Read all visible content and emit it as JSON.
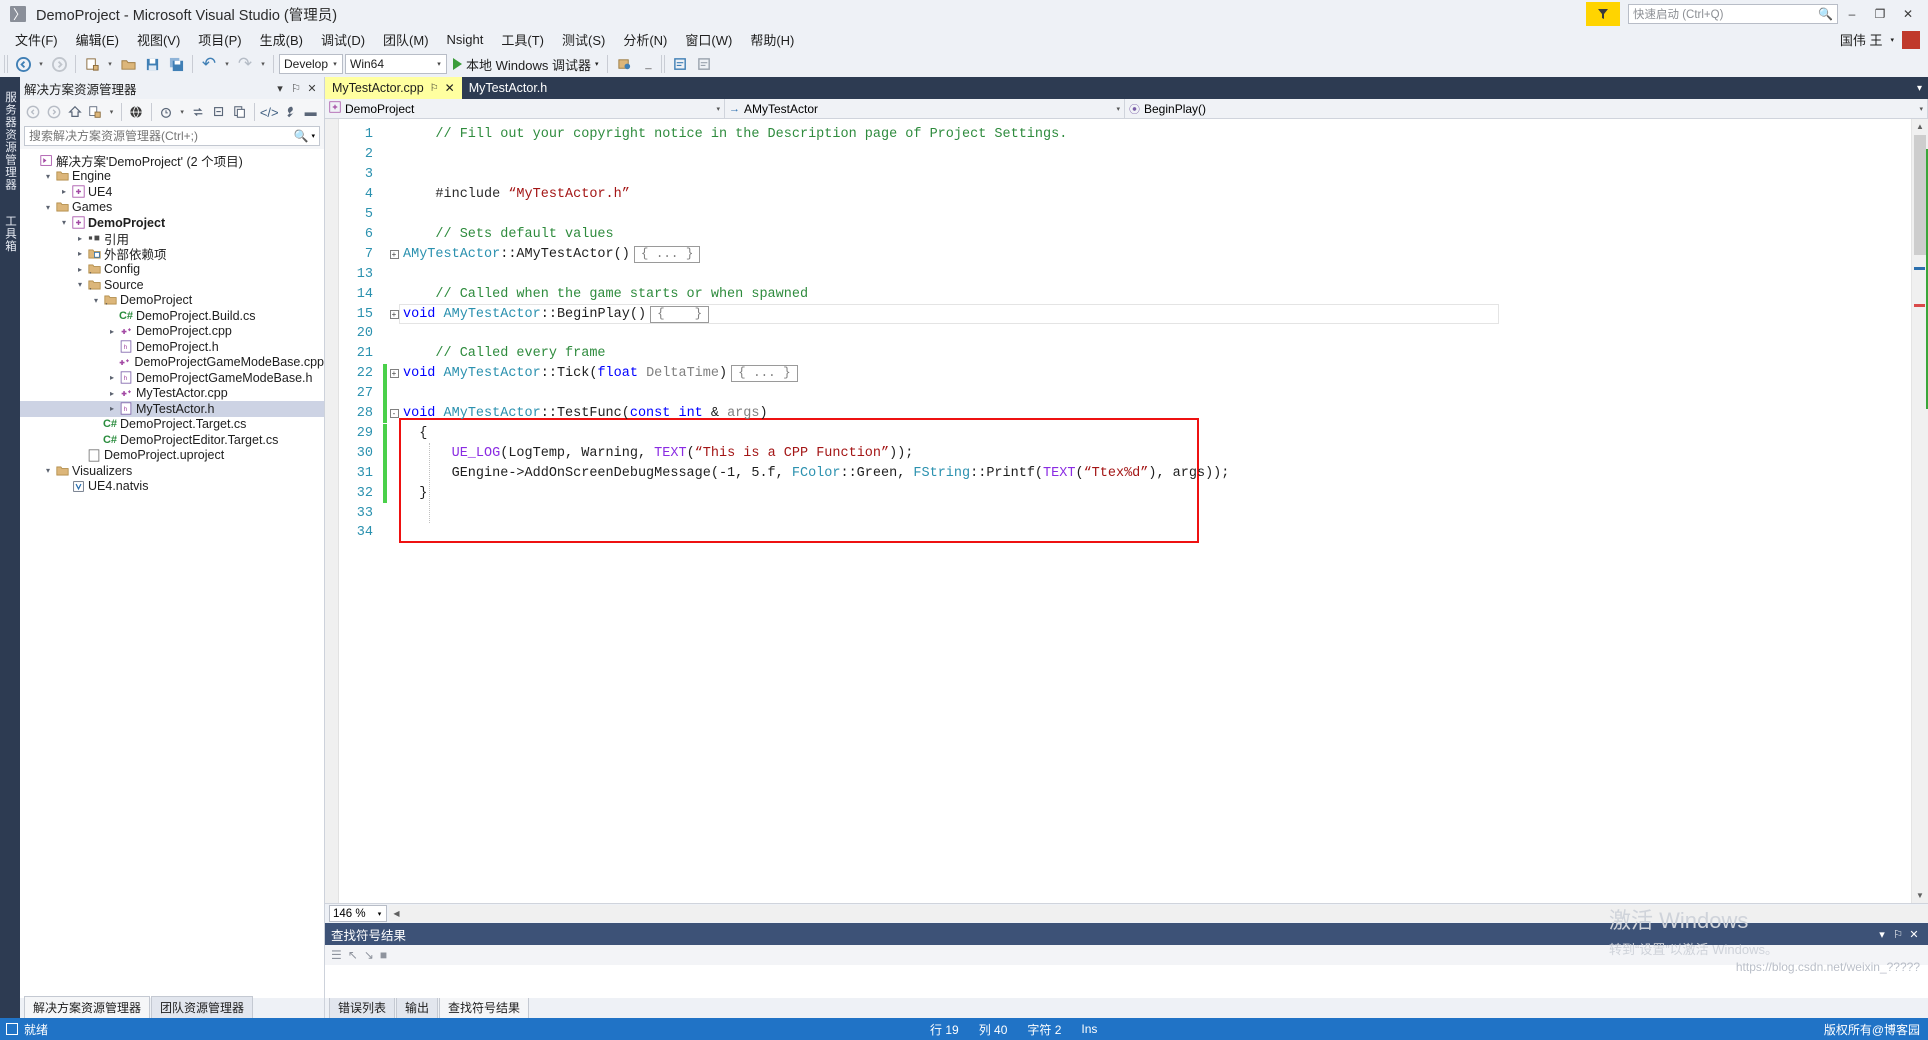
{
  "window": {
    "title": "DemoProject - Microsoft Visual Studio (管理员)",
    "logo_icon": "visual-studio-logo",
    "minimize": "–",
    "maximize": "❐",
    "close": "✕"
  },
  "menubar": {
    "items": [
      {
        "label": "文件(F)"
      },
      {
        "label": "编辑(E)"
      },
      {
        "label": "视图(V)"
      },
      {
        "label": "项目(P)"
      },
      {
        "label": "生成(B)"
      },
      {
        "label": "调试(D)"
      },
      {
        "label": "团队(M)"
      },
      {
        "label": "Nsight"
      },
      {
        "label": "工具(T)"
      },
      {
        "label": "测试(S)"
      },
      {
        "label": "分析(N)"
      },
      {
        "label": "窗口(W)"
      },
      {
        "label": "帮助(H)"
      }
    ],
    "user": "国伟 王",
    "user_caret": "▾",
    "user_badge": "■"
  },
  "quick_launch": {
    "placeholder": "快速启动 (Ctrl+Q)",
    "icon": "search-icon"
  },
  "toolbar": {
    "back_icon": "◀",
    "forward_icon": "▶",
    "new_item_icon": "⬚",
    "open_icon": "◱",
    "save_icon": "Ὃe",
    "save_all_icon": "❐",
    "undo_icon": "↶",
    "redo_icon": "↷",
    "config": "Develop",
    "platform": "Win64",
    "run_label": "本地 Windows 调试器",
    "caret": "▾"
  },
  "left_strip": {
    "tabs": [
      "服务器资源管理器",
      "工具箱"
    ]
  },
  "solution_explorer": {
    "title": "解决方案资源管理器",
    "header_buttons": [
      "▾",
      "⚐",
      "✕"
    ],
    "toolbar_icons": [
      "back-icon",
      "forward-icon",
      "home-icon",
      "sync-with-active-document-icon",
      "caret-down-icon",
      "show-all-files-icon",
      "pending-changes-filter-icon",
      "refresh-icon",
      "collapse-all-icon",
      "properties-icon",
      "view-code-icon",
      "properties-wrench-icon",
      "preview-icon"
    ],
    "search_placeholder": "搜索解决方案资源管理器(Ctrl+;)",
    "search_icon": "magnifier-icon",
    "tree": [
      {
        "depth": 0,
        "expander": "",
        "icon": "solution",
        "label": "解决方案'DemoProject' (2 个项目)",
        "bold": false,
        "selected": false
      },
      {
        "depth": 1,
        "expander": "▾",
        "icon": "folder",
        "label": "Engine",
        "bold": false,
        "selected": false
      },
      {
        "depth": 2,
        "expander": "▸",
        "icon": "project",
        "label": "UE4",
        "bold": false,
        "selected": false
      },
      {
        "depth": 1,
        "expander": "▾",
        "icon": "folder",
        "label": "Games",
        "bold": false,
        "selected": false
      },
      {
        "depth": 2,
        "expander": "▾",
        "icon": "project",
        "label": "DemoProject",
        "bold": true,
        "selected": false
      },
      {
        "depth": 3,
        "expander": "▸",
        "icon": "references",
        "label": "引用",
        "bold": false,
        "selected": false
      },
      {
        "depth": 3,
        "expander": "▸",
        "icon": "extdeps",
        "label": "外部依赖项",
        "bold": false,
        "selected": false
      },
      {
        "depth": 3,
        "expander": "▸",
        "icon": "filter-folder",
        "label": "Config",
        "bold": false,
        "selected": false
      },
      {
        "depth": 3,
        "expander": "▾",
        "icon": "filter-folder",
        "label": "Source",
        "bold": false,
        "selected": false
      },
      {
        "depth": 4,
        "expander": "▾",
        "icon": "filter-folder",
        "label": "DemoProject",
        "bold": false,
        "selected": false
      },
      {
        "depth": 5,
        "expander": "",
        "icon": "csharp",
        "label": "DemoProject.Build.cs",
        "bold": false,
        "selected": false
      },
      {
        "depth": 5,
        "expander": "▸",
        "icon": "cpp",
        "label": "DemoProject.cpp",
        "bold": false,
        "selected": false
      },
      {
        "depth": 5,
        "expander": "",
        "icon": "header",
        "label": "DemoProject.h",
        "bold": false,
        "selected": false
      },
      {
        "depth": 5,
        "expander": "",
        "icon": "cpp",
        "label": "DemoProjectGameModeBase.cpp",
        "bold": false,
        "selected": false
      },
      {
        "depth": 5,
        "expander": "▸",
        "icon": "header",
        "label": "DemoProjectGameModeBase.h",
        "bold": false,
        "selected": false
      },
      {
        "depth": 5,
        "expander": "▸",
        "icon": "cpp",
        "label": "MyTestActor.cpp",
        "bold": false,
        "selected": false
      },
      {
        "depth": 5,
        "expander": "▸",
        "icon": "header",
        "label": "MyTestActor.h",
        "bold": false,
        "selected": true
      },
      {
        "depth": 4,
        "expander": "",
        "icon": "csharp",
        "label": "DemoProject.Target.cs",
        "bold": false,
        "selected": false
      },
      {
        "depth": 4,
        "expander": "",
        "icon": "csharp",
        "label": "DemoProjectEditor.Target.cs",
        "bold": false,
        "selected": false
      },
      {
        "depth": 3,
        "expander": "",
        "icon": "file",
        "label": "DemoProject.uproject",
        "bold": false,
        "selected": false
      },
      {
        "depth": 1,
        "expander": "▾",
        "icon": "folder",
        "label": "Visualizers",
        "bold": false,
        "selected": false
      },
      {
        "depth": 2,
        "expander": "",
        "icon": "natvis",
        "label": "UE4.natvis",
        "bold": false,
        "selected": false
      }
    ],
    "bottom_tabs": [
      {
        "label": "解决方案资源管理器",
        "active": true
      },
      {
        "label": "团队资源管理器",
        "active": false
      }
    ]
  },
  "editor": {
    "tabs": [
      {
        "label": "MyTestActor.cpp",
        "active": true,
        "pin": "⚐",
        "close": "✕"
      },
      {
        "label": "MyTestActor.h",
        "active": false
      }
    ],
    "navbar": {
      "project": "DemoProject",
      "project_icon": "project-icon",
      "class": "AMyTestActor",
      "class_icon": "→",
      "member": "BeginPlay()",
      "member_icon": "⦿",
      "caret": "▾"
    },
    "zoom": "146 %",
    "lines": [
      {
        "num": "1",
        "changebar": "none",
        "fold": "",
        "segments": [
          {
            "t": "    // Fill out your copyright notice in the Description page of Project Settings.",
            "c": "c-com"
          }
        ]
      },
      {
        "num": "2",
        "changebar": "none",
        "fold": "",
        "segments": []
      },
      {
        "num": "3",
        "changebar": "none",
        "fold": "",
        "segments": []
      },
      {
        "num": "4",
        "changebar": "none",
        "fold": "",
        "segments": [
          {
            "t": "    #include ",
            "c": "c-pre"
          },
          {
            "t": "“MyTestActor.h”",
            "c": "c-str"
          }
        ]
      },
      {
        "num": "5",
        "changebar": "none",
        "fold": "",
        "segments": []
      },
      {
        "num": "6",
        "changebar": "none",
        "fold": "",
        "segments": [
          {
            "t": "    // Sets default values",
            "c": "c-com"
          }
        ]
      },
      {
        "num": "7",
        "changebar": "none",
        "fold": "+",
        "segments": [
          {
            "t": "AMyTestActor",
            "c": "c-type"
          },
          {
            "t": "::",
            "c": "c-id"
          },
          {
            "t": "AMyTestActor",
            "c": "c-fn"
          },
          {
            "t": "()",
            "c": "c-id"
          }
        ],
        "collapsed": "{ ... }"
      },
      {
        "num": "13",
        "changebar": "none",
        "fold": "",
        "segments": []
      },
      {
        "num": "14",
        "changebar": "none",
        "fold": "",
        "segments": [
          {
            "t": "    // Called when the game starts or when spawned",
            "c": "c-com"
          }
        ]
      },
      {
        "num": "15",
        "changebar": "none",
        "fold": "+",
        "segments": [
          {
            "t": "void ",
            "c": "c-kw"
          },
          {
            "t": "AMyTestActor",
            "c": "c-type"
          },
          {
            "t": "::",
            "c": "c-id"
          },
          {
            "t": "BeginPlay",
            "c": "c-fn"
          },
          {
            "t": "()",
            "c": "c-id"
          }
        ],
        "collapsed": "{    }",
        "current": true
      },
      {
        "num": "20",
        "changebar": "none",
        "fold": "",
        "segments": []
      },
      {
        "num": "21",
        "changebar": "none",
        "fold": "",
        "segments": [
          {
            "t": "    // Called every frame",
            "c": "c-com"
          }
        ]
      },
      {
        "num": "22",
        "changebar": "green",
        "fold": "+",
        "segments": [
          {
            "t": "void ",
            "c": "c-kw"
          },
          {
            "t": "AMyTestActor",
            "c": "c-type"
          },
          {
            "t": "::",
            "c": "c-id"
          },
          {
            "t": "Tick",
            "c": "c-fn"
          },
          {
            "t": "(",
            "c": "c-id"
          },
          {
            "t": "float ",
            "c": "c-kw"
          },
          {
            "t": "DeltaTime",
            "c": "c-dim"
          },
          {
            "t": ")",
            "c": "c-id"
          }
        ],
        "collapsed": "{ ... }"
      },
      {
        "num": "27",
        "changebar": "green",
        "fold": "",
        "segments": []
      },
      {
        "num": "28",
        "changebar": "green",
        "fold": "-",
        "segments": [
          {
            "t": "void ",
            "c": "c-kw"
          },
          {
            "t": "AMyTestActor",
            "c": "c-type"
          },
          {
            "t": "::",
            "c": "c-id"
          },
          {
            "t": "TestFunc",
            "c": "c-fn"
          },
          {
            "t": "(",
            "c": "c-id"
          },
          {
            "t": "const int ",
            "c": "c-kw"
          },
          {
            "t": "& ",
            "c": "c-id"
          },
          {
            "t": "args",
            "c": "c-dim"
          },
          {
            "t": ")",
            "c": "c-id"
          }
        ]
      },
      {
        "num": "29",
        "changebar": "green",
        "fold": "",
        "segments": [
          {
            "t": "  {",
            "c": "c-id"
          }
        ]
      },
      {
        "num": "30",
        "changebar": "green",
        "fold": "",
        "segments": [
          {
            "t": "      ",
            "c": "c-id"
          },
          {
            "t": "UE_LOG",
            "c": "c-macro"
          },
          {
            "t": "(LogTemp, Warning, ",
            "c": "c-id"
          },
          {
            "t": "TEXT",
            "c": "c-macro"
          },
          {
            "t": "(",
            "c": "c-id"
          },
          {
            "t": "“This is a CPP Function”",
            "c": "c-str"
          },
          {
            "t": "));",
            "c": "c-id"
          }
        ]
      },
      {
        "num": "31",
        "changebar": "green",
        "fold": "",
        "segments": [
          {
            "t": "      GEngine->AddOnScreenDebugMessage(-1, 5.f, ",
            "c": "c-id"
          },
          {
            "t": "FColor",
            "c": "c-type"
          },
          {
            "t": "::Green, ",
            "c": "c-id"
          },
          {
            "t": "FString",
            "c": "c-type"
          },
          {
            "t": "::Printf(",
            "c": "c-id"
          },
          {
            "t": "TEXT",
            "c": "c-macro"
          },
          {
            "t": "(",
            "c": "c-id"
          },
          {
            "t": "“Ttex%d”",
            "c": "c-str"
          },
          {
            "t": "), args));",
            "c": "c-id"
          }
        ]
      },
      {
        "num": "32",
        "changebar": "green",
        "fold": "",
        "segments": [
          {
            "t": "  }",
            "c": "c-id"
          }
        ]
      },
      {
        "num": "33",
        "changebar": "none",
        "fold": "",
        "segments": []
      },
      {
        "num": "34",
        "changebar": "none",
        "fold": "",
        "segments": []
      }
    ]
  },
  "bottom_panel": {
    "title": "查找符号结果",
    "header_buttons": [
      "▾",
      "⚐",
      "✕"
    ],
    "toolbar_icons": [
      "list-icon",
      "prev-icon",
      "next-icon",
      "stop-icon"
    ],
    "tabs": [
      {
        "label": "错误列表",
        "active": false
      },
      {
        "label": "输出",
        "active": false
      },
      {
        "label": "查找符号结果",
        "active": true
      }
    ]
  },
  "watermark": {
    "line1": "激活 Windows",
    "line2": "转到“设置”以激活 Windows。",
    "csdn_url": "https://blog.csdn.net/weixin_?????",
    "csdn_id": "版权所有@博客园"
  },
  "statusbar": {
    "ready": "就绪",
    "ready_icon": "status-icon",
    "row_label": "行 19",
    "col_label": "列 40",
    "char_label": "字符 2",
    "ins_label": "Ins"
  },
  "colors": {
    "accent": "#2073c6",
    "tab_active": "#ffffa0",
    "tabstrip": "#2d3b52",
    "changebar_green": "#4ad04a",
    "redbox": "#ee1111"
  }
}
